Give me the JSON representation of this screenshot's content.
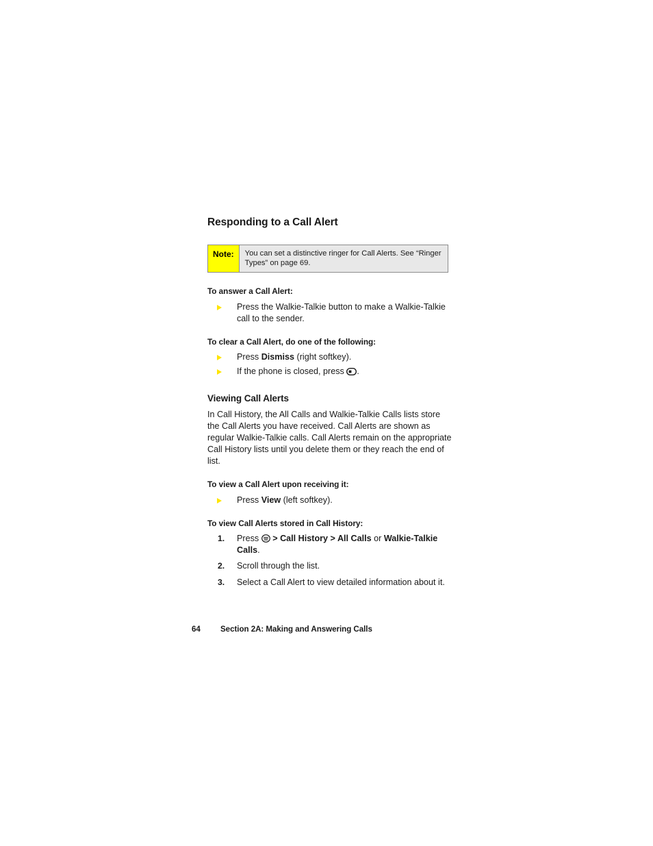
{
  "page": {
    "section_heading": "Responding to a Call Alert",
    "note": {
      "label": "Note:",
      "text": "You can set a distinctive ringer for Call Alerts. See “Ringer Types” on page 69."
    },
    "answer_leadin": "To answer a Call Alert:",
    "answer_bullets": [
      "Press the Walkie-Talkie button to make a Walkie-Talkie call to the sender."
    ],
    "clear_leadin": "To clear a Call Alert, do one of the following:",
    "clear_bullet_1": {
      "before": "Press ",
      "bold": "Dismiss",
      "after": " (right softkey)."
    },
    "clear_bullet_2": {
      "before": "If the phone is closed, press ",
      "icon": "phone-softkey-icon",
      "after": "."
    },
    "viewing_heading": "Viewing Call Alerts",
    "viewing_paragraph": "In Call History, the All Calls and Walkie-Talkie Calls lists store the Call Alerts you have received. Call Alerts are shown as regular Walkie-Talkie calls. Call Alerts remain on the appropriate Call History lists until you delete them or they reach the end of list.",
    "view_upon_leadin": "To view a Call Alert upon receiving it:",
    "view_upon_bullet": {
      "before": "Press ",
      "bold": "View",
      "after": " (left softkey)."
    },
    "view_stored_leadin": "To view Call Alerts stored in Call History:",
    "steps": [
      {
        "number": "1.",
        "before": "Press ",
        "icon": "menu-key-icon",
        "sep1": " > ",
        "bold1": "Call History",
        "sep2": " > ",
        "bold2": "All Calls",
        "mid": " or ",
        "bold3": "Walkie-Talkie Calls",
        "after": "."
      },
      {
        "number": "2.",
        "text": "Scroll through the list."
      },
      {
        "number": "3.",
        "text": "Select a Call Alert to view detailed information about it."
      }
    ],
    "footer": {
      "page_number": "64",
      "section_label": "Section 2A: Making and Answering Calls"
    },
    "colors": {
      "note_label_bg": "#ffff00",
      "note_body_bg": "#e8e8e8",
      "note_border": "#8c8c8c",
      "bullet_marker": "#ffe500",
      "text": "#1a1a1a"
    }
  }
}
